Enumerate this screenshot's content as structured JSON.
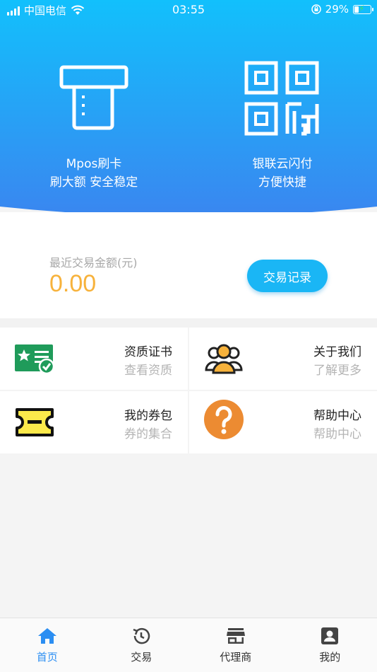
{
  "status_bar": {
    "carrier": "中国电信",
    "time": "03:55",
    "battery": "29%"
  },
  "hero": {
    "left_action": {
      "title": "Mpos刷卡",
      "subtitle": "刷大额 安全稳定",
      "icon": "card-reader-icon"
    },
    "right_action": {
      "title": "银联云闪付",
      "subtitle": "方便快捷",
      "icon": "qr-code-icon"
    }
  },
  "summary": {
    "label": "最近交易金额(元)",
    "amount": "0.00",
    "history_button": "交易记录"
  },
  "cards": [
    {
      "title": "资质证书",
      "subtitle": "查看资质",
      "icon": "certificate-icon"
    },
    {
      "title": "关于我们",
      "subtitle": "了解更多",
      "icon": "team-icon"
    },
    {
      "title": "我的券包",
      "subtitle": "券的集合",
      "icon": "ticket-icon"
    },
    {
      "title": "帮助中心",
      "subtitle": "帮助中心",
      "icon": "help-icon"
    }
  ],
  "tabbar": {
    "tabs": [
      {
        "label": "首页",
        "icon": "home-icon",
        "active": true
      },
      {
        "label": "交易",
        "icon": "history-icon",
        "active": false
      },
      {
        "label": "代理商",
        "icon": "store-icon",
        "active": false
      },
      {
        "label": "我的",
        "icon": "profile-icon",
        "active": false
      }
    ]
  },
  "colors": {
    "hero_top": "#12c0fc",
    "hero_bottom": "#3a86f0",
    "accent_amount": "#f7b23b",
    "button": "#1ab6f5",
    "tab_active": "#2b8ef2"
  }
}
